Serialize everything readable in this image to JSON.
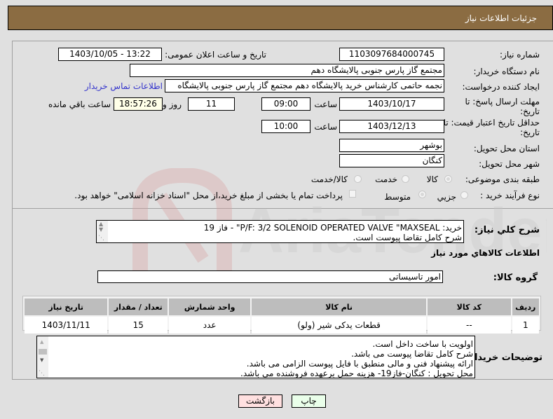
{
  "header": {
    "title": "جزئیات اطلاعات نیاز"
  },
  "form": {
    "need_number": {
      "label": "شماره نیاز:",
      "value": "1103097684000745"
    },
    "announce": {
      "label": "تاریخ و ساعت اعلان عمومی:",
      "value": "1403/10/05 - 13:22"
    },
    "buyer_org": {
      "label": "نام دستگاه خریدار:",
      "value": "مجتمع گاز پارس جنوبی  پالایشگاه دهم"
    },
    "requester": {
      "label": "ایجاد کننده درخواست:",
      "value": "نجمه حاتمی کارشناس خرید پالایشگاه دهم  مجتمع گاز پارس جنوبی  پالایشگاه",
      "contact_link": "اطلاعات تماس خریدار"
    },
    "deadline": {
      "label_line1": "مهلت ارسال پاسخ: تا",
      "label_line2": "تاریخ:",
      "date": "1403/10/17",
      "time_label": "ساعت",
      "time": "09:00",
      "days": "11",
      "days_label": "روز و",
      "remaining": "18:57:26",
      "remaining_label": "ساعت باقي مانده"
    },
    "validity": {
      "label_line1": "حداقل تاریخ اعتبار قیمت: تا",
      "label_line2": "تاریخ:",
      "date": "1403/12/13",
      "time_label": "ساعت",
      "time": "10:00"
    },
    "province": {
      "label": "استان محل تحویل:",
      "value": "بوشهر"
    },
    "city": {
      "label": "شهر محل تحویل:",
      "value": "کنگان"
    },
    "category": {
      "label": "طبقه بندی موضوعی:",
      "options": [
        "کالا",
        "خدمت",
        "کالا/خدمت"
      ],
      "selected": "کالا"
    },
    "purchase_type": {
      "label": "نوع فرآیند خرید :",
      "options": [
        "جزیي",
        "متوسط"
      ],
      "selected": "متوسط",
      "payment_note": "پرداخت تمام یا بخشی از مبلغ خرید،از محل \"اسناد خزانه اسلامی\" خواهد بود."
    }
  },
  "description": {
    "label": "شرح كلي نياز:",
    "line1": "خرید: P/F: 3/2 SOLENOID OPERATED VALVE \"MAXSEAL\" - فاز 19",
    "line2": "شرح کامل تقاضا پیوست است."
  },
  "items_section": {
    "title": "اطلاعات كالاهاي مورد نياز",
    "group_label": "گروه کالا:",
    "group_value": "امور تاسیساتی",
    "columns": [
      "ردیف",
      "کد کالا",
      "نام کالا",
      "واحد شمارش",
      "تعداد / مقدار",
      "تاریخ نیاز"
    ],
    "rows": [
      [
        "1",
        "--",
        "قطعات یدکی شیر (ولو)",
        "عدد",
        "15",
        "1403/11/11"
      ]
    ]
  },
  "buyer_notes": {
    "label": "توضیحات خریدار:",
    "lines": [
      "اولویت با ساخت داخل است.",
      "شرح کامل تقاضا پیوست می باشد.",
      "ارائه پیشنهاد فنی و مالی منطبق با فایل پیوست الزامی می باشد.",
      "محل تحویل : کنگان-فاز19- هزینه حمل برعهده فروشنده می باشد."
    ]
  },
  "buttons": {
    "print": "چاپ",
    "back": "بازگشت"
  },
  "colors": {
    "header_bg": "#8b6c42",
    "print_bg": "#eaffea",
    "back_bg": "#ffe0e0",
    "link": "#3333cc"
  }
}
